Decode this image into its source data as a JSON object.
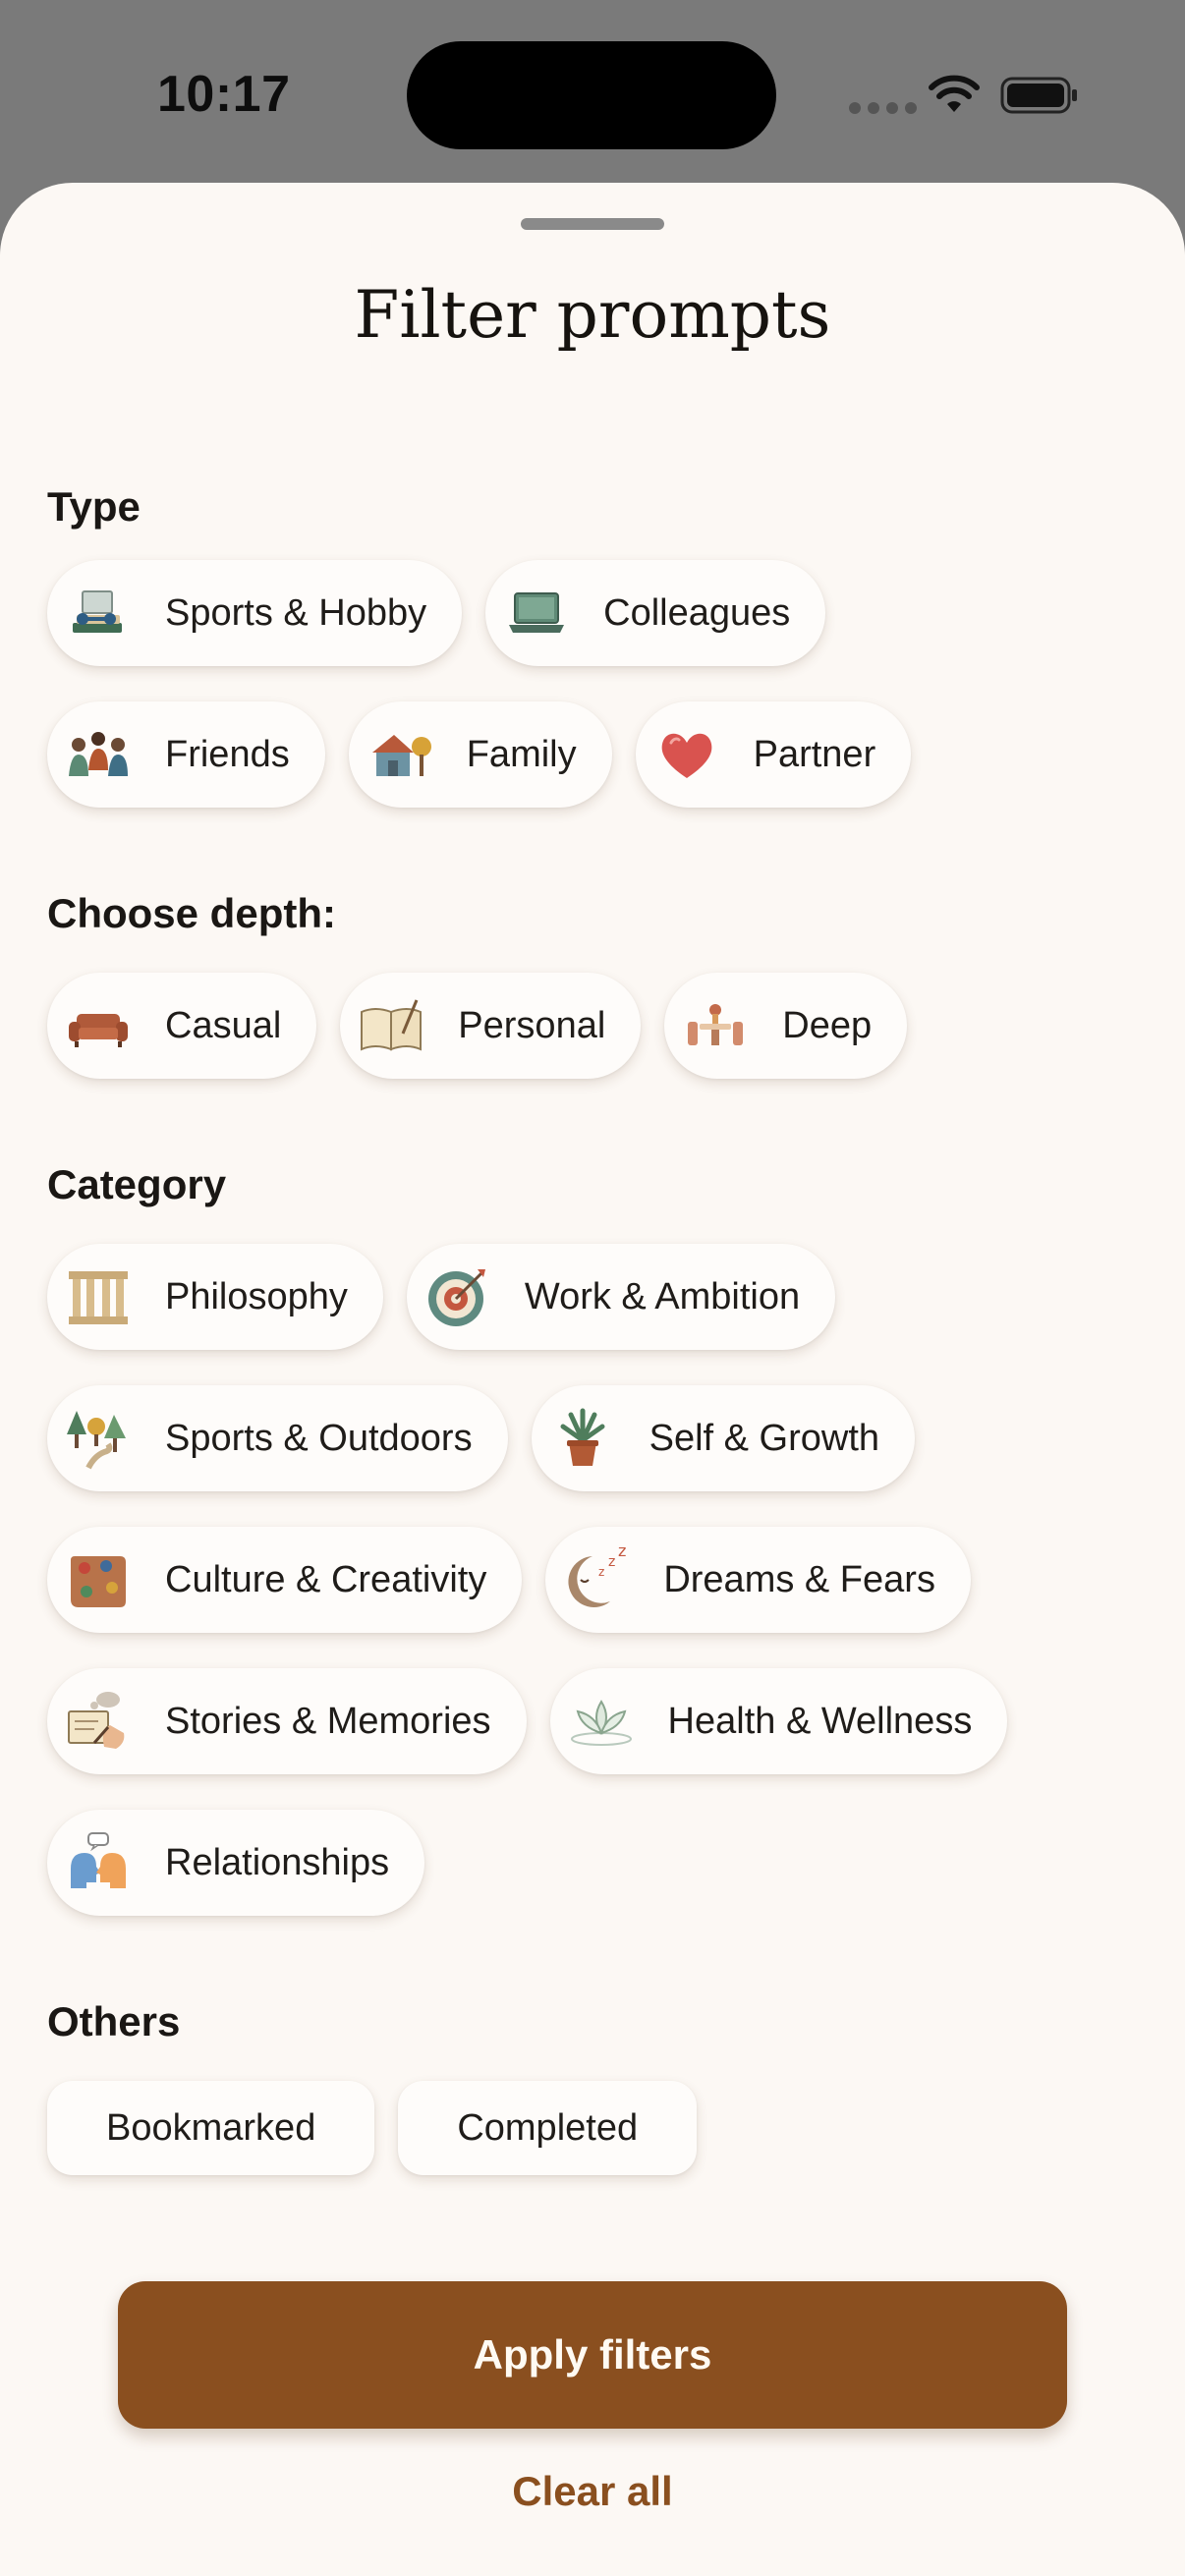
{
  "status_bar": {
    "time": "10:17"
  },
  "sheet": {
    "title": "Filter prompts",
    "sections": {
      "type": {
        "label": "Type",
        "chips": [
          {
            "label": "Sports & Hobby",
            "icon": "books-dumbbell-icon"
          },
          {
            "label": "Colleagues",
            "icon": "laptop-icon"
          },
          {
            "label": "Friends",
            "icon": "friends-talking-icon"
          },
          {
            "label": "Family",
            "icon": "house-icon"
          },
          {
            "label": "Partner",
            "icon": "heart-icon"
          }
        ]
      },
      "depth": {
        "label": "Choose depth:",
        "chips": [
          {
            "label": "Casual",
            "icon": "sofa-icon"
          },
          {
            "label": "Personal",
            "icon": "open-book-icon"
          },
          {
            "label": "Deep",
            "icon": "table-chairs-icon"
          }
        ]
      },
      "category": {
        "label": "Category",
        "chips": [
          {
            "label": "Philosophy",
            "icon": "columns-icon"
          },
          {
            "label": "Work & Ambition",
            "icon": "target-icon"
          },
          {
            "label": "Sports & Outdoors",
            "icon": "trees-path-icon"
          },
          {
            "label": "Self & Growth",
            "icon": "potted-plant-icon"
          },
          {
            "label": "Culture & Creativity",
            "icon": "paint-palette-icon"
          },
          {
            "label": "Dreams & Fears",
            "icon": "sleeping-moon-icon"
          },
          {
            "label": "Stories & Memories",
            "icon": "writing-hand-icon"
          },
          {
            "label": "Health & Wellness",
            "icon": "lotus-icon"
          },
          {
            "label": "Relationships",
            "icon": "two-heads-talking-icon"
          }
        ]
      },
      "others": {
        "label": "Others",
        "chips": [
          {
            "label": "Bookmarked"
          },
          {
            "label": "Completed"
          }
        ]
      }
    },
    "apply_label": "Apply filters",
    "clear_label": "Clear all"
  },
  "colors": {
    "accent": "#8a4f1f",
    "sheet_bg": "#fcf8f4",
    "backdrop": "#7a7a7a"
  }
}
